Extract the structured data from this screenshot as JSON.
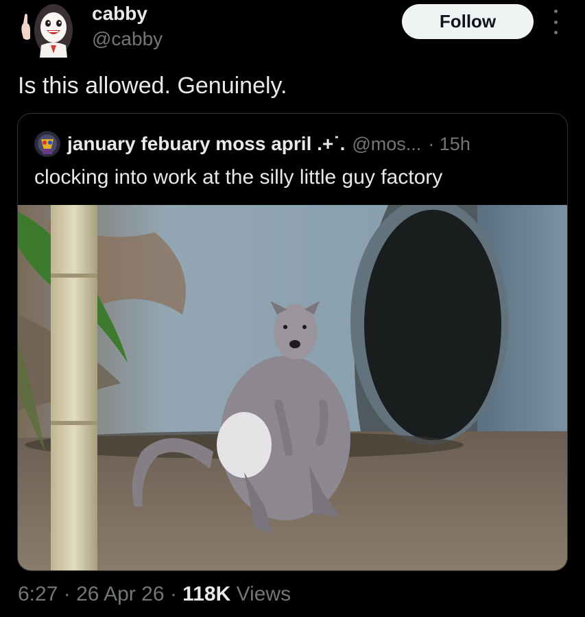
{
  "author": {
    "name": "cabby",
    "handle": "@cabby",
    "follow_label": "Follow",
    "more_icon": "more-vertical-icon"
  },
  "tweet": {
    "text": "Is this allowed. Genuinely."
  },
  "quote": {
    "name": "january febuary moss april .+˙.",
    "handle": "@mos...",
    "time": "· 15h",
    "text": "clocking into work at the silly little guy factory",
    "image_alt": "wallaby standing in front of a hollow log"
  },
  "meta": {
    "time": "6:27",
    "sep1": " · ",
    "date": "26 Apr 26",
    "sep2": " · ",
    "views_count": "118K",
    "views_label": " Views"
  },
  "colors": {
    "background": "#000000",
    "text_primary": "#e7e9ea",
    "text_secondary": "#71767b",
    "border": "#2f3336",
    "follow_bg": "#eff3f4"
  }
}
